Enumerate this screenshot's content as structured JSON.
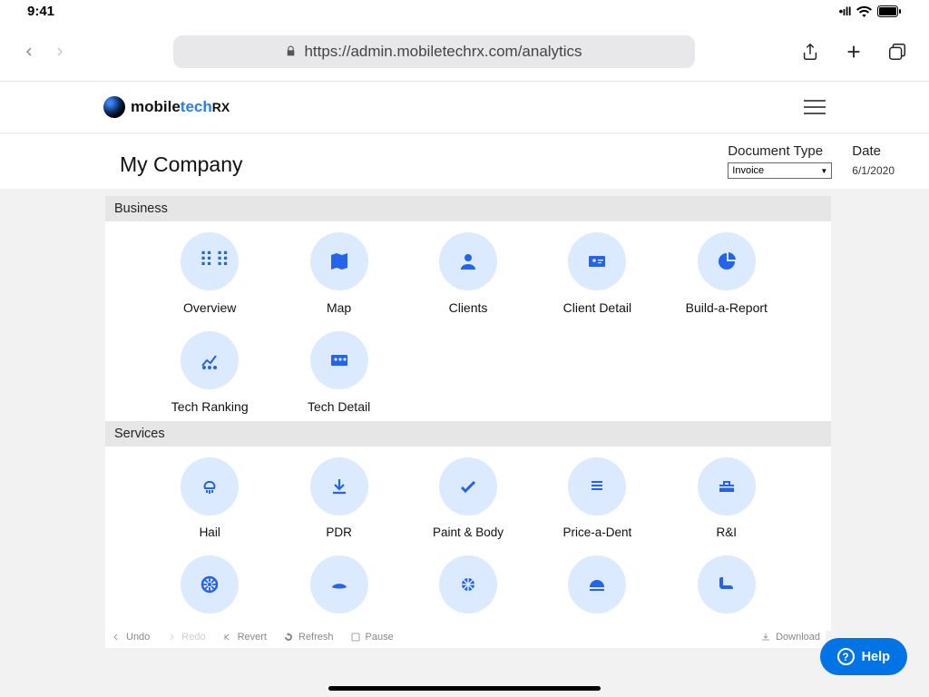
{
  "status": {
    "time": "9:41",
    "signal": "▮▮▮▮",
    "wifi": "wifi",
    "battery": "battery"
  },
  "browser": {
    "url": "https://admin.mobiletechrx.com/analytics"
  },
  "logo": {
    "part1": "mobile",
    "part2": "tech",
    "part3": "RX"
  },
  "company": "My Company",
  "filters": {
    "docTypeLabel": "Document Type",
    "docTypeValue": "Invoice",
    "dateLabel": "Date",
    "dateValue": "6/1/2020"
  },
  "sections": {
    "business": {
      "title": "Business",
      "tiles": [
        {
          "label": "Overview",
          "icon": "grid"
        },
        {
          "label": "Map",
          "icon": "map"
        },
        {
          "label": "Clients",
          "icon": "person"
        },
        {
          "label": "Client Detail",
          "icon": "id-card"
        },
        {
          "label": "Build-a-Report",
          "icon": "pie"
        },
        {
          "label": "Tech Ranking",
          "icon": "ranking"
        },
        {
          "label": "Tech Detail",
          "icon": "people-detail"
        }
      ]
    },
    "services": {
      "title": "Services",
      "tiles": [
        {
          "label": "Hail",
          "icon": "hail"
        },
        {
          "label": "PDR",
          "icon": "download"
        },
        {
          "label": "Paint & Body",
          "icon": "check"
        },
        {
          "label": "Price-a-Dent",
          "icon": "list"
        },
        {
          "label": "R&I",
          "icon": "toolbox"
        },
        {
          "label": "",
          "icon": "wheel"
        },
        {
          "label": "",
          "icon": "windshield"
        },
        {
          "label": "",
          "icon": "ball"
        },
        {
          "label": "",
          "icon": "dome"
        },
        {
          "label": "",
          "icon": "seat"
        }
      ]
    }
  },
  "toolbar": {
    "undo": "Undo",
    "redo": "Redo",
    "revert": "Revert",
    "refresh": "Refresh",
    "pause": "Pause",
    "download": "Download"
  },
  "help": "Help"
}
